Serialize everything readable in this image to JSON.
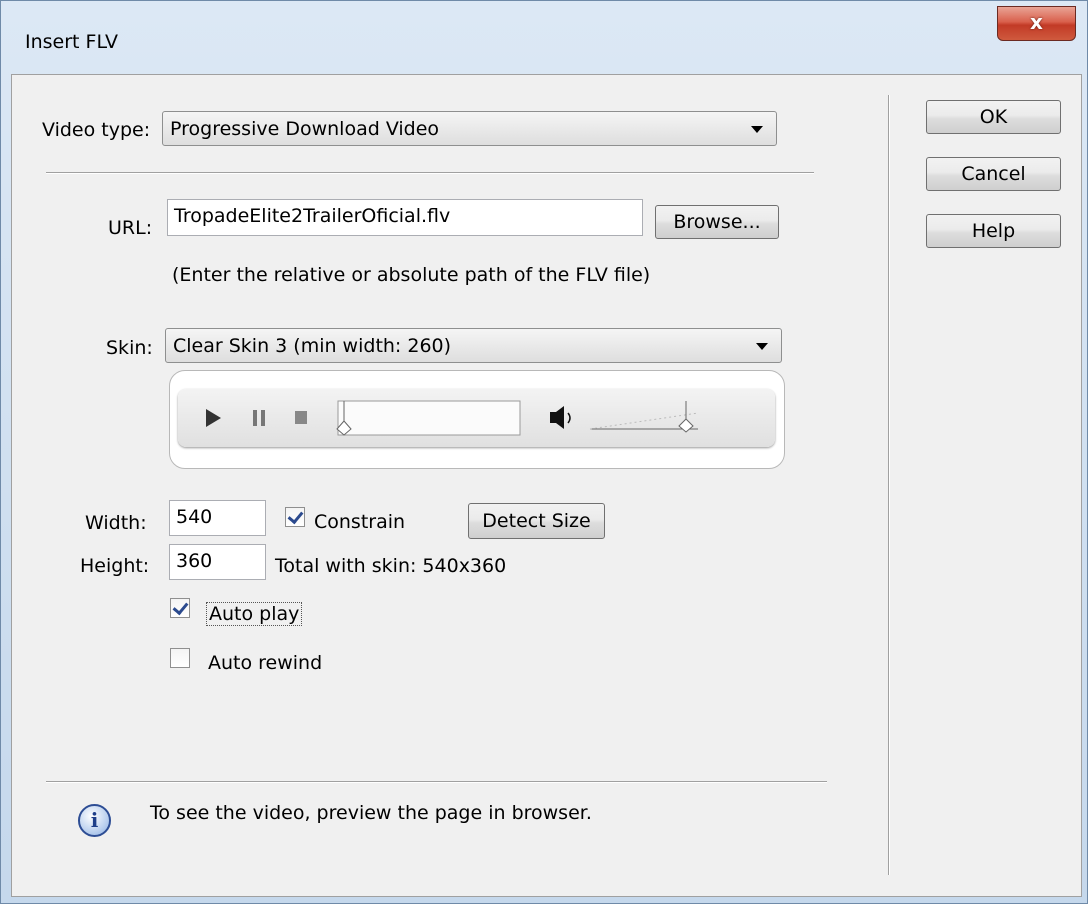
{
  "window": {
    "title": "Insert FLV",
    "close_label": "x"
  },
  "video_type": {
    "label": "Video type:",
    "selected": "Progressive Download Video"
  },
  "url": {
    "label": "URL:",
    "value": "TropadeElite2TrailerOficial.flv",
    "browse_label": "Browse...",
    "hint": "(Enter the relative or absolute path of the FLV file)"
  },
  "skin": {
    "label": "Skin:",
    "selected": "Clear Skin 3 (min width: 260)"
  },
  "size": {
    "width_label": "Width:",
    "width_value": "540",
    "height_label": "Height:",
    "height_value": "360",
    "constrain_label": "Constrain",
    "constrain_checked": true,
    "detect_label": "Detect Size",
    "total_label": "Total with skin: 540x360"
  },
  "options": {
    "auto_play_label": "Auto play",
    "auto_play_checked": true,
    "auto_rewind_label": "Auto rewind",
    "auto_rewind_checked": false
  },
  "info": {
    "text": "To see the video, preview the page in browser.",
    "icon": "info-icon"
  },
  "buttons": {
    "ok": "OK",
    "cancel": "Cancel",
    "help": "Help"
  }
}
